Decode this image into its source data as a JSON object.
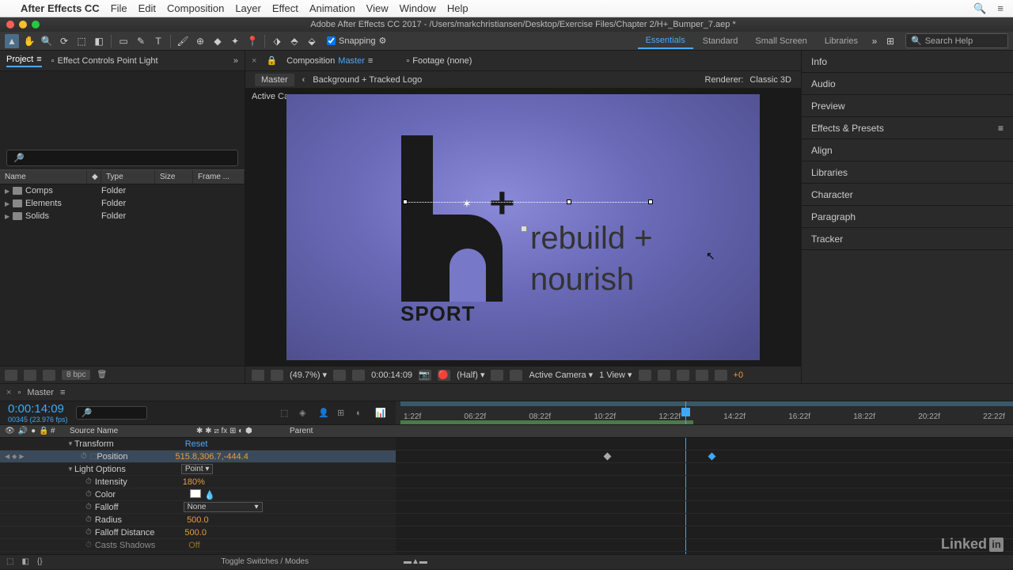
{
  "mac_menu": {
    "app": "After Effects CC",
    "items": [
      "File",
      "Edit",
      "Composition",
      "Layer",
      "Effect",
      "Animation",
      "View",
      "Window",
      "Help"
    ]
  },
  "app_title": "Adobe After Effects CC 2017 - /Users/markchristiansen/Desktop/Exercise Files/Chapter 2/H+_Bumper_7.aep *",
  "toolbar": {
    "snapping_label": "Snapping",
    "workspaces": [
      "Essentials",
      "Standard",
      "Small Screen",
      "Libraries"
    ],
    "active_workspace": 0,
    "search_placeholder": "Search Help"
  },
  "left_panel": {
    "tabs": {
      "project": "Project",
      "effect_controls": "Effect Controls Point Light"
    },
    "columns": {
      "name": "Name",
      "type": "Type",
      "size": "Size",
      "frame": "Frame ..."
    },
    "items": [
      {
        "name": "Comps",
        "type": "Folder"
      },
      {
        "name": "Elements",
        "type": "Folder"
      },
      {
        "name": "Solids",
        "type": "Folder"
      }
    ],
    "bpc": "8 bpc"
  },
  "center": {
    "comp_tab_prefix": "Composition",
    "comp_tab_name": "Master",
    "footage_tab": "Footage (none)",
    "breadcrumb": {
      "a": "Master",
      "b": "Background + Tracked Logo"
    },
    "renderer_label": "Renderer:",
    "renderer_value": "Classic 3D",
    "camera_label": "Active Camera",
    "canvas_text": {
      "rebuild": "rebuild +",
      "nourish": "nourish",
      "sport": "SPORT",
      "plus": "+"
    },
    "footer": {
      "zoom": "(49.7%)",
      "time": "0:00:14:09",
      "res": "(Half)",
      "camera": "Active Camera",
      "view": "1 View",
      "exp": "+0"
    }
  },
  "right_panel": {
    "items": [
      "Info",
      "Audio",
      "Preview",
      "Effects & Presets",
      "Align",
      "Libraries",
      "Character",
      "Paragraph",
      "Tracker"
    ]
  },
  "timeline": {
    "tab": "Master",
    "timecode": "0:00:14:09",
    "timecode_sub": "00345 (23.976 fps)",
    "ruler": [
      "1:22f",
      "06:22f",
      "08:22f",
      "10:22f",
      "12:22f",
      "14:22f",
      "16:22f",
      "18:22f",
      "20:22f",
      "22:22f"
    ],
    "cols": {
      "source": "Source Name",
      "parent": "Parent"
    },
    "rows": {
      "transform": {
        "label": "Transform",
        "value": "Reset"
      },
      "position": {
        "label": "Position",
        "value": "515.8,306.7,-444.4"
      },
      "light_options": {
        "label": "Light Options",
        "value": "Point"
      },
      "intensity": {
        "label": "Intensity",
        "value": "180%"
      },
      "color": {
        "label": "Color"
      },
      "falloff": {
        "label": "Falloff",
        "value": "None"
      },
      "radius": {
        "label": "Radius",
        "value": "500.0"
      },
      "falloff_distance": {
        "label": "Falloff Distance",
        "value": "500.0"
      },
      "casts_shadows": {
        "label": "Casts Shadows",
        "value": "Off"
      }
    },
    "footer_toggle": "Toggle Switches / Modes"
  },
  "branding": "Linked"
}
